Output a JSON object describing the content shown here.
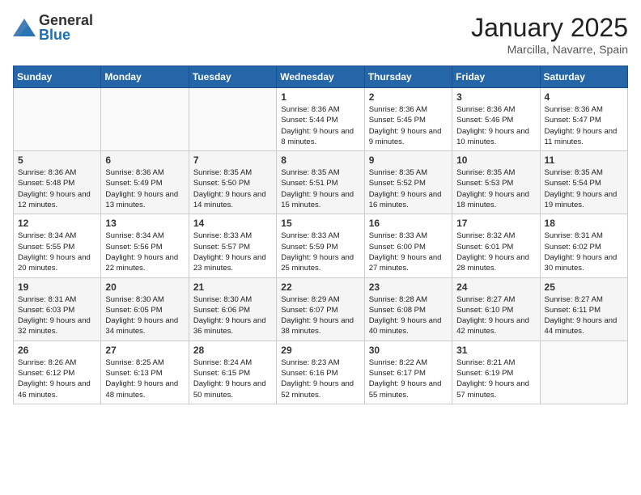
{
  "header": {
    "logo_general": "General",
    "logo_blue": "Blue",
    "month_year": "January 2025",
    "location": "Marcilla, Navarre, Spain"
  },
  "days_of_week": [
    "Sunday",
    "Monday",
    "Tuesday",
    "Wednesday",
    "Thursday",
    "Friday",
    "Saturday"
  ],
  "weeks": [
    {
      "shaded": false,
      "days": [
        {
          "day": "",
          "sunrise": "",
          "sunset": "",
          "daylight": ""
        },
        {
          "day": "",
          "sunrise": "",
          "sunset": "",
          "daylight": ""
        },
        {
          "day": "",
          "sunrise": "",
          "sunset": "",
          "daylight": ""
        },
        {
          "day": "1",
          "sunrise": "Sunrise: 8:36 AM",
          "sunset": "Sunset: 5:44 PM",
          "daylight": "Daylight: 9 hours and 8 minutes."
        },
        {
          "day": "2",
          "sunrise": "Sunrise: 8:36 AM",
          "sunset": "Sunset: 5:45 PM",
          "daylight": "Daylight: 9 hours and 9 minutes."
        },
        {
          "day": "3",
          "sunrise": "Sunrise: 8:36 AM",
          "sunset": "Sunset: 5:46 PM",
          "daylight": "Daylight: 9 hours and 10 minutes."
        },
        {
          "day": "4",
          "sunrise": "Sunrise: 8:36 AM",
          "sunset": "Sunset: 5:47 PM",
          "daylight": "Daylight: 9 hours and 11 minutes."
        }
      ]
    },
    {
      "shaded": true,
      "days": [
        {
          "day": "5",
          "sunrise": "Sunrise: 8:36 AM",
          "sunset": "Sunset: 5:48 PM",
          "daylight": "Daylight: 9 hours and 12 minutes."
        },
        {
          "day": "6",
          "sunrise": "Sunrise: 8:36 AM",
          "sunset": "Sunset: 5:49 PM",
          "daylight": "Daylight: 9 hours and 13 minutes."
        },
        {
          "day": "7",
          "sunrise": "Sunrise: 8:35 AM",
          "sunset": "Sunset: 5:50 PM",
          "daylight": "Daylight: 9 hours and 14 minutes."
        },
        {
          "day": "8",
          "sunrise": "Sunrise: 8:35 AM",
          "sunset": "Sunset: 5:51 PM",
          "daylight": "Daylight: 9 hours and 15 minutes."
        },
        {
          "day": "9",
          "sunrise": "Sunrise: 8:35 AM",
          "sunset": "Sunset: 5:52 PM",
          "daylight": "Daylight: 9 hours and 16 minutes."
        },
        {
          "day": "10",
          "sunrise": "Sunrise: 8:35 AM",
          "sunset": "Sunset: 5:53 PM",
          "daylight": "Daylight: 9 hours and 18 minutes."
        },
        {
          "day": "11",
          "sunrise": "Sunrise: 8:35 AM",
          "sunset": "Sunset: 5:54 PM",
          "daylight": "Daylight: 9 hours and 19 minutes."
        }
      ]
    },
    {
      "shaded": false,
      "days": [
        {
          "day": "12",
          "sunrise": "Sunrise: 8:34 AM",
          "sunset": "Sunset: 5:55 PM",
          "daylight": "Daylight: 9 hours and 20 minutes."
        },
        {
          "day": "13",
          "sunrise": "Sunrise: 8:34 AM",
          "sunset": "Sunset: 5:56 PM",
          "daylight": "Daylight: 9 hours and 22 minutes."
        },
        {
          "day": "14",
          "sunrise": "Sunrise: 8:33 AM",
          "sunset": "Sunset: 5:57 PM",
          "daylight": "Daylight: 9 hours and 23 minutes."
        },
        {
          "day": "15",
          "sunrise": "Sunrise: 8:33 AM",
          "sunset": "Sunset: 5:59 PM",
          "daylight": "Daylight: 9 hours and 25 minutes."
        },
        {
          "day": "16",
          "sunrise": "Sunrise: 8:33 AM",
          "sunset": "Sunset: 6:00 PM",
          "daylight": "Daylight: 9 hours and 27 minutes."
        },
        {
          "day": "17",
          "sunrise": "Sunrise: 8:32 AM",
          "sunset": "Sunset: 6:01 PM",
          "daylight": "Daylight: 9 hours and 28 minutes."
        },
        {
          "day": "18",
          "sunrise": "Sunrise: 8:31 AM",
          "sunset": "Sunset: 6:02 PM",
          "daylight": "Daylight: 9 hours and 30 minutes."
        }
      ]
    },
    {
      "shaded": true,
      "days": [
        {
          "day": "19",
          "sunrise": "Sunrise: 8:31 AM",
          "sunset": "Sunset: 6:03 PM",
          "daylight": "Daylight: 9 hours and 32 minutes."
        },
        {
          "day": "20",
          "sunrise": "Sunrise: 8:30 AM",
          "sunset": "Sunset: 6:05 PM",
          "daylight": "Daylight: 9 hours and 34 minutes."
        },
        {
          "day": "21",
          "sunrise": "Sunrise: 8:30 AM",
          "sunset": "Sunset: 6:06 PM",
          "daylight": "Daylight: 9 hours and 36 minutes."
        },
        {
          "day": "22",
          "sunrise": "Sunrise: 8:29 AM",
          "sunset": "Sunset: 6:07 PM",
          "daylight": "Daylight: 9 hours and 38 minutes."
        },
        {
          "day": "23",
          "sunrise": "Sunrise: 8:28 AM",
          "sunset": "Sunset: 6:08 PM",
          "daylight": "Daylight: 9 hours and 40 minutes."
        },
        {
          "day": "24",
          "sunrise": "Sunrise: 8:27 AM",
          "sunset": "Sunset: 6:10 PM",
          "daylight": "Daylight: 9 hours and 42 minutes."
        },
        {
          "day": "25",
          "sunrise": "Sunrise: 8:27 AM",
          "sunset": "Sunset: 6:11 PM",
          "daylight": "Daylight: 9 hours and 44 minutes."
        }
      ]
    },
    {
      "shaded": false,
      "days": [
        {
          "day": "26",
          "sunrise": "Sunrise: 8:26 AM",
          "sunset": "Sunset: 6:12 PM",
          "daylight": "Daylight: 9 hours and 46 minutes."
        },
        {
          "day": "27",
          "sunrise": "Sunrise: 8:25 AM",
          "sunset": "Sunset: 6:13 PM",
          "daylight": "Daylight: 9 hours and 48 minutes."
        },
        {
          "day": "28",
          "sunrise": "Sunrise: 8:24 AM",
          "sunset": "Sunset: 6:15 PM",
          "daylight": "Daylight: 9 hours and 50 minutes."
        },
        {
          "day": "29",
          "sunrise": "Sunrise: 8:23 AM",
          "sunset": "Sunset: 6:16 PM",
          "daylight": "Daylight: 9 hours and 52 minutes."
        },
        {
          "day": "30",
          "sunrise": "Sunrise: 8:22 AM",
          "sunset": "Sunset: 6:17 PM",
          "daylight": "Daylight: 9 hours and 55 minutes."
        },
        {
          "day": "31",
          "sunrise": "Sunrise: 8:21 AM",
          "sunset": "Sunset: 6:19 PM",
          "daylight": "Daylight: 9 hours and 57 minutes."
        },
        {
          "day": "",
          "sunrise": "",
          "sunset": "",
          "daylight": ""
        }
      ]
    }
  ]
}
